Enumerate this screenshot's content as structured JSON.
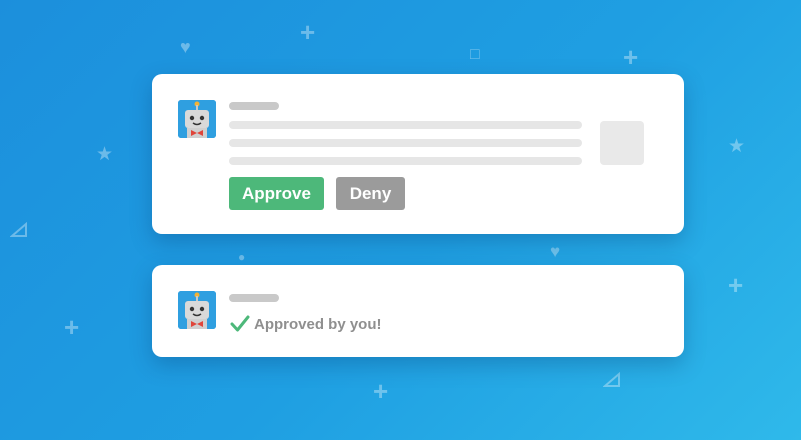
{
  "request_card": {
    "approve_label": "Approve",
    "deny_label": "Deny"
  },
  "result_card": {
    "status_text": "Approved by you!"
  },
  "decorations": {
    "plus": "+",
    "heart": "♥",
    "star": "★",
    "square": "□",
    "dot": "●"
  },
  "colors": {
    "background": "#1f9fe2",
    "approve": "#4db87a",
    "deny": "#9b9b9b",
    "check": "#4db87a"
  }
}
